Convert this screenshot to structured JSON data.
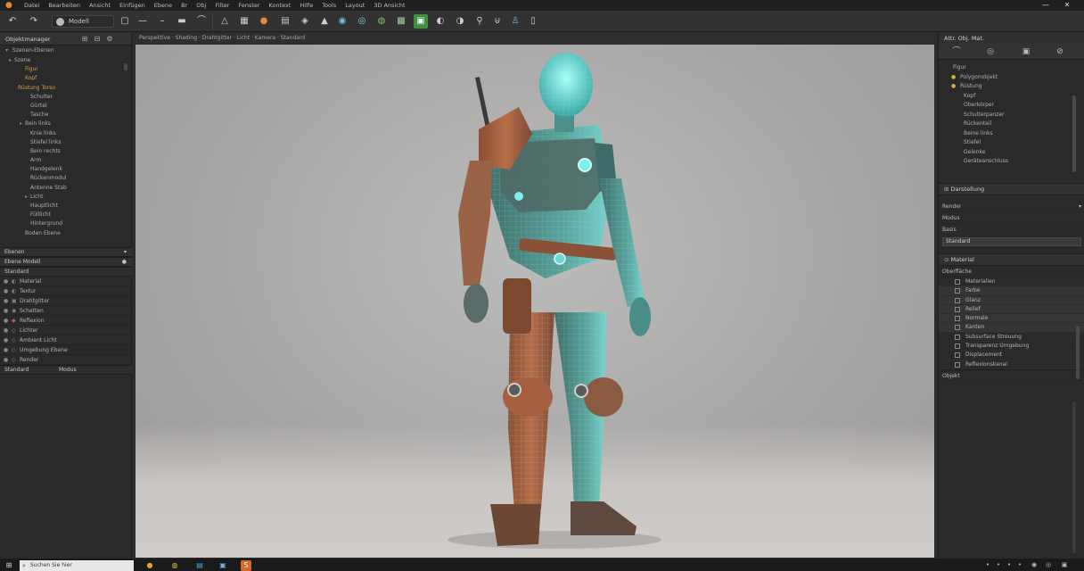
{
  "menubar": {
    "items": [
      "Datei",
      "Bearbeiten",
      "Ansicht",
      "Einfügen",
      "Ebene",
      "Br",
      "Obj",
      "Filter",
      "Fenster",
      "Kontext",
      "Hilfe",
      "Tools",
      "Layout",
      "3D Ansicht"
    ],
    "window_controls": {
      "minimize": "—",
      "maximize": "❐",
      "close": "✕"
    }
  },
  "toolbar": {
    "mode_label": "Modell"
  },
  "left_panel": {
    "header_title": "Objektmanager",
    "scene_header": "Szenen-Ebenen",
    "tree": [
      {
        "label": "Szene",
        "bullet": "▸",
        "orange": false,
        "indent": 10
      },
      {
        "label": "Figur",
        "bullet": "",
        "orange": true,
        "indent": 22
      },
      {
        "label": "Kopf",
        "bullet": "",
        "orange": true,
        "indent": 22
      },
      {
        "label": "Rüstung Torso",
        "bullet": "",
        "orange": true,
        "indent": 14
      },
      {
        "label": "Schulter",
        "bullet": "",
        "orange": false,
        "indent": 28
      },
      {
        "label": "Gürtel",
        "bullet": "",
        "orange": false,
        "indent": 28
      },
      {
        "label": "Tasche",
        "bullet": "",
        "orange": false,
        "indent": 28
      },
      {
        "label": "Bein links",
        "bullet": "▸",
        "orange": false,
        "indent": 22
      },
      {
        "label": "Knie links",
        "bullet": "",
        "orange": false,
        "indent": 28
      },
      {
        "label": "Stiefel links",
        "bullet": "",
        "orange": false,
        "indent": 28
      },
      {
        "label": "Bein rechts",
        "bullet": "",
        "orange": false,
        "indent": 28
      },
      {
        "label": "Arm",
        "bullet": "",
        "orange": false,
        "indent": 28
      },
      {
        "label": "Handgelenk",
        "bullet": "",
        "orange": false,
        "indent": 28
      },
      {
        "label": "Rückenmodul",
        "bullet": "",
        "orange": false,
        "indent": 28
      },
      {
        "label": "Antenne Stab",
        "bullet": "",
        "orange": false,
        "indent": 28
      },
      {
        "label": "Licht",
        "bullet": "▸",
        "orange": false,
        "indent": 28
      },
      {
        "label": "Hauptlicht",
        "bullet": "",
        "orange": false,
        "indent": 28
      },
      {
        "label": "Fülllicht",
        "bullet": "",
        "orange": false,
        "indent": 28
      },
      {
        "label": "Hintergrund",
        "bullet": "",
        "orange": false,
        "indent": 28
      },
      {
        "label": "Boden Ebene",
        "bullet": "",
        "orange": false,
        "indent": 22
      }
    ],
    "layers_header": "Ebenen",
    "layers_sub": "Ebene Modell",
    "layers_sub2": "Standard",
    "layers_sub2_right": "Modus",
    "layers": [
      {
        "label": "Material",
        "icon": "◐",
        "red": false
      },
      {
        "label": "Textur",
        "icon": "◐",
        "red": false
      },
      {
        "label": "Drahtgitter",
        "icon": "▣",
        "red": false
      },
      {
        "label": "Schatten",
        "icon": "◉",
        "red": false
      },
      {
        "label": "Reflexion",
        "icon": "◆",
        "red": true
      },
      {
        "label": "Lichter",
        "icon": "◇",
        "red": false
      },
      {
        "label": "Ambient Licht",
        "icon": "◇",
        "red": false
      },
      {
        "label": "Umgebung Ebene",
        "icon": "◇",
        "red": false
      },
      {
        "label": "Render",
        "icon": "◇",
        "red": false
      }
    ]
  },
  "viewport": {
    "info_bar": "Perspektive · Shading · Drahtgitter · Licht · Kamera · Standard"
  },
  "right_panel": {
    "tabs_label": "Attr. Obj. Mat.",
    "tree": [
      {
        "label": "Figur",
        "bullet": ""
      },
      {
        "label": "Polygonobjekt",
        "bullet": "●"
      },
      {
        "label": "Rüstung",
        "bullet": "●"
      },
      {
        "label": "Kopf",
        "bullet": ""
      },
      {
        "label": "Oberkörper",
        "bullet": ""
      },
      {
        "label": "Schulterpanzer",
        "bullet": ""
      },
      {
        "label": "Rückenteil",
        "bullet": ""
      },
      {
        "label": "Beine links",
        "bullet": ""
      },
      {
        "label": "Stiefel",
        "bullet": ""
      },
      {
        "label": "Gelenke",
        "bullet": ""
      },
      {
        "label": "Geräteanschluss",
        "bullet": ""
      }
    ],
    "section_display": "Darstellung",
    "field_render": "Render",
    "field_mode": "Modus",
    "field_basis": "Basis",
    "input_value": "Standard",
    "section_material": "Material",
    "material_sub": "Oberfläche",
    "material_list": [
      {
        "label": "Materialien",
        "highlight": false
      },
      {
        "label": "Farbe",
        "highlight": true
      },
      {
        "label": "Glanz",
        "highlight": true
      },
      {
        "label": "Relief",
        "highlight": true
      },
      {
        "label": "Normale",
        "highlight": true
      },
      {
        "label": "Kanten",
        "highlight": true
      },
      {
        "label": "Subsurface Streuung",
        "highlight": false
      },
      {
        "label": "Transparenz Umgebung",
        "highlight": false
      },
      {
        "label": "Displacement",
        "highlight": false
      },
      {
        "label": "Reflexionskanal",
        "highlight": false
      }
    ],
    "footer_label": "Objekt"
  },
  "taskbar": {
    "search_placeholder": "Suchen Sie hier"
  }
}
